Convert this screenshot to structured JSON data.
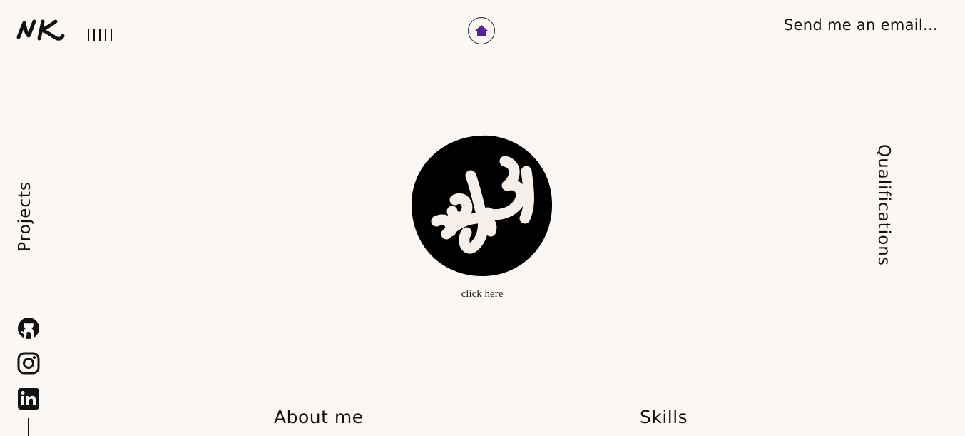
{
  "header": {
    "logo_text": "NK",
    "email_link": "Send me an email..."
  },
  "nav": {
    "projects": "Projects",
    "qualifications": "Qualifications"
  },
  "hero": {
    "click_label": "click here"
  },
  "social": [
    {
      "name": "github-icon"
    },
    {
      "name": "instagram-icon"
    },
    {
      "name": "linkedin-icon"
    }
  ],
  "sections": {
    "about": "About me",
    "skills": "Skills"
  },
  "colors": {
    "background": "#fbf7f4",
    "text": "#111111",
    "home_accent": "#5b1f9e"
  }
}
